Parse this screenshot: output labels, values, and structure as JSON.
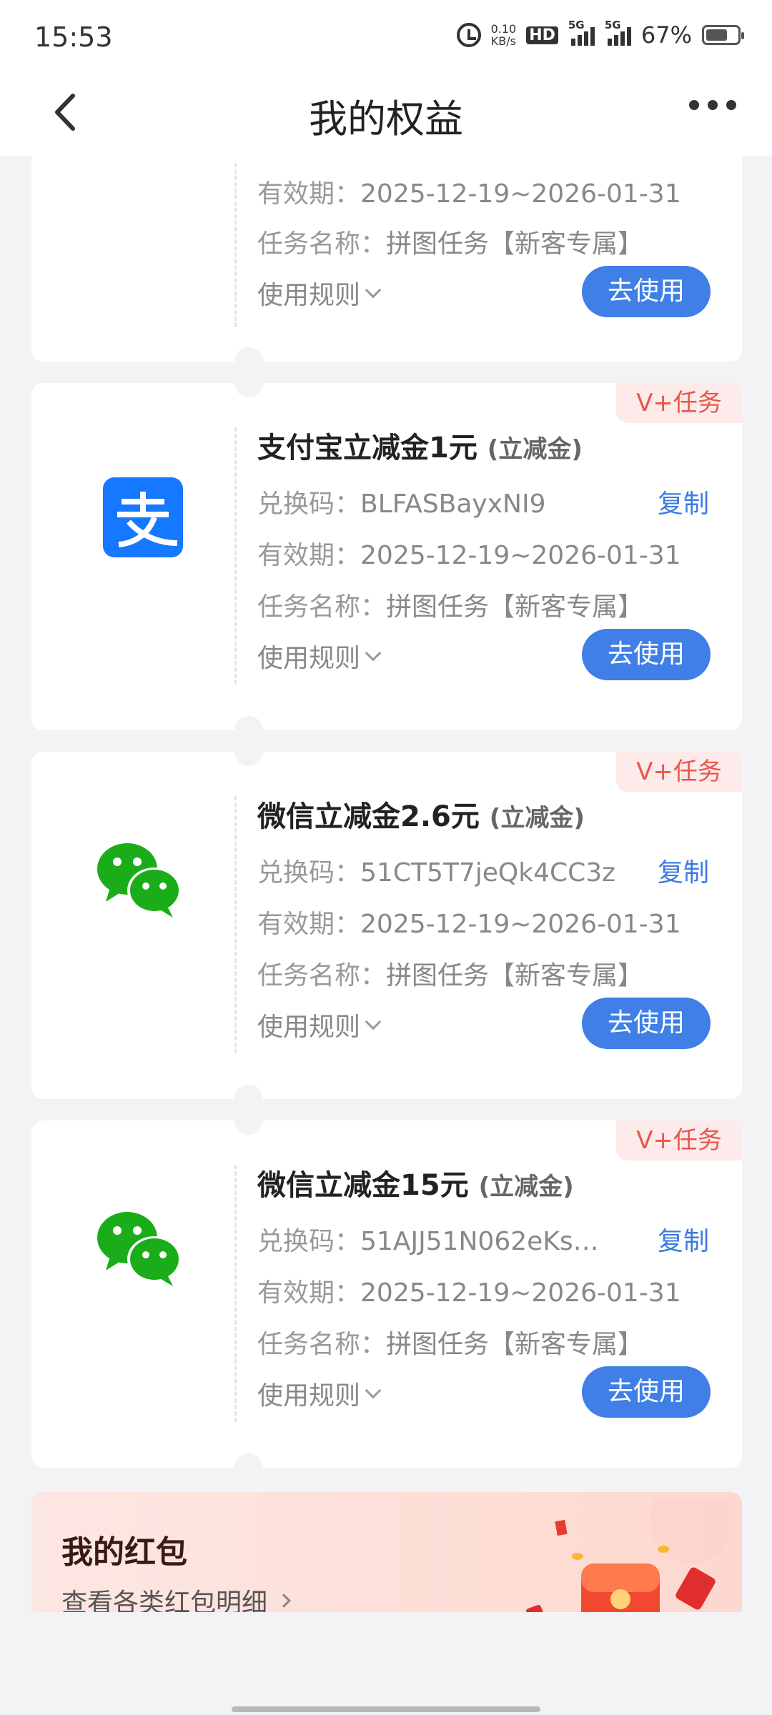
{
  "status_bar": {
    "time": "15:53",
    "net_speed_value": "0.10",
    "net_speed_unit": "KB/s",
    "hd": "HD",
    "sim1": "5G",
    "sim2": "5G",
    "battery": "67%"
  },
  "nav": {
    "title": "我的权益"
  },
  "labels": {
    "code": "兑换码：",
    "validity": "有效期：",
    "task": "任务名称：",
    "rules": "使用规则",
    "copy": "复制",
    "use": "去使用"
  },
  "cards": [
    {
      "validity": "2025-12-19~2026-01-31",
      "task": "拼图任务【新客专属】"
    },
    {
      "badge": "V+任务",
      "title": "支付宝立减金1元",
      "type": "(立减金)",
      "logo": "alipay-icon",
      "code": "BLFASBayxNI9",
      "validity": "2025-12-19~2026-01-31",
      "task": "拼图任务【新客专属】"
    },
    {
      "badge": "V+任务",
      "title": "微信立减金2.6元",
      "type": "(立减金)",
      "logo": "wechat-icon",
      "code": "51CT5T7jeQk4CC3z",
      "validity": "2025-12-19~2026-01-31",
      "task": "拼图任务【新客专属】"
    },
    {
      "badge": "V+任务",
      "title": "微信立减金15元",
      "type": "(立减金)",
      "logo": "wechat-icon",
      "code": "51AJJ51N062eKs…",
      "validity": "2025-12-19~2026-01-31",
      "task": "拼图任务【新客专属】"
    }
  ],
  "red_packet": {
    "title": "我的红包",
    "subtitle": "查看各类红包明细"
  },
  "colors": {
    "accent_blue": "#3f7fe6",
    "badge_red": "#e8574a",
    "wechat_green": "#1aad19",
    "alipay_blue": "#1677ff"
  }
}
